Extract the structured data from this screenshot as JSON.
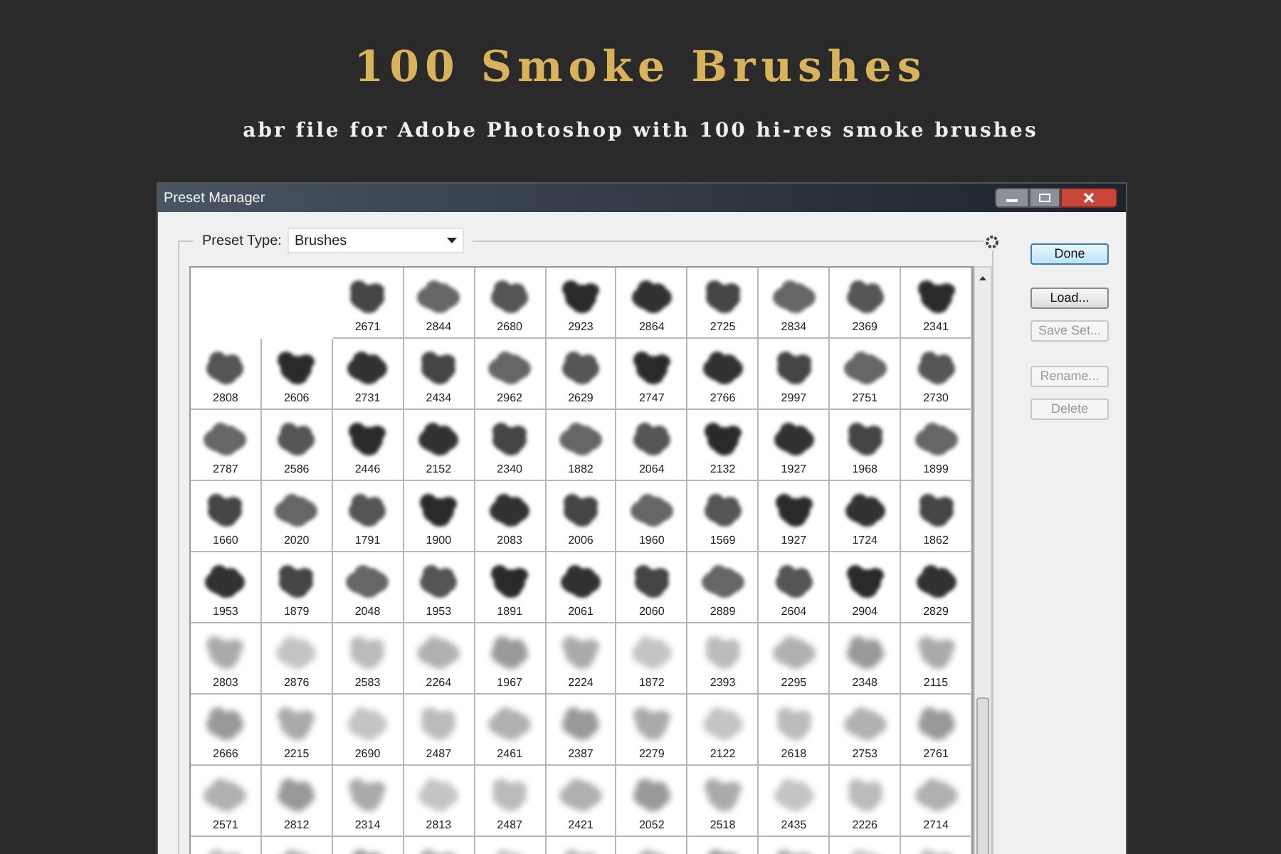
{
  "header": {
    "title": "100 Smoke Brushes",
    "subtitle": "abr file for Adobe Photoshop with 100 hi-res smoke brushes"
  },
  "window": {
    "title": "Preset Manager"
  },
  "preset_type": {
    "label": "Preset Type:",
    "value": "Brushes"
  },
  "brush_rows": [
    [
      {
        "kind": "empty"
      },
      {
        "kind": "empty"
      },
      {
        "kind": "brush",
        "label": "2671"
      },
      {
        "kind": "brush",
        "label": "2844"
      },
      {
        "kind": "brush",
        "label": "2680"
      },
      {
        "kind": "brush",
        "label": "2923"
      },
      {
        "kind": "brush",
        "label": "2864"
      },
      {
        "kind": "brush",
        "label": "2725"
      },
      {
        "kind": "brush",
        "label": "2834"
      },
      {
        "kind": "brush",
        "label": "2369"
      },
      {
        "kind": "brush",
        "label": "2341"
      }
    ],
    [
      {
        "kind": "brush",
        "label": "2808"
      },
      {
        "kind": "brush",
        "label": "2606"
      },
      {
        "kind": "brush",
        "label": "2731"
      },
      {
        "kind": "brush",
        "label": "2434"
      },
      {
        "kind": "brush",
        "label": "2962"
      },
      {
        "kind": "brush",
        "label": "2629"
      },
      {
        "kind": "brush",
        "label": "2747"
      },
      {
        "kind": "brush",
        "label": "2766"
      },
      {
        "kind": "brush",
        "label": "2997"
      },
      {
        "kind": "brush",
        "label": "2751"
      },
      {
        "kind": "brush",
        "label": "2730"
      }
    ],
    [
      {
        "kind": "brush",
        "label": "2787"
      },
      {
        "kind": "brush",
        "label": "2586"
      },
      {
        "kind": "brush",
        "label": "2446"
      },
      {
        "kind": "brush",
        "label": "2152"
      },
      {
        "kind": "brush",
        "label": "2340"
      },
      {
        "kind": "brush",
        "label": "1882"
      },
      {
        "kind": "brush",
        "label": "2064"
      },
      {
        "kind": "brush",
        "label": "2132"
      },
      {
        "kind": "brush",
        "label": "1927"
      },
      {
        "kind": "brush",
        "label": "1968"
      },
      {
        "kind": "brush",
        "label": "1899"
      }
    ],
    [
      {
        "kind": "brush",
        "label": "1660"
      },
      {
        "kind": "brush",
        "label": "2020"
      },
      {
        "kind": "brush",
        "label": "1791"
      },
      {
        "kind": "brush",
        "label": "1900"
      },
      {
        "kind": "brush",
        "label": "2083"
      },
      {
        "kind": "brush",
        "label": "2006"
      },
      {
        "kind": "brush",
        "label": "1960"
      },
      {
        "kind": "brush",
        "label": "1569"
      },
      {
        "kind": "brush",
        "label": "1927"
      },
      {
        "kind": "brush",
        "label": "1724"
      },
      {
        "kind": "brush",
        "label": "1862"
      }
    ],
    [
      {
        "kind": "brush",
        "label": "1953"
      },
      {
        "kind": "brush",
        "label": "1879"
      },
      {
        "kind": "brush",
        "label": "2048"
      },
      {
        "kind": "brush",
        "label": "1953"
      },
      {
        "kind": "brush",
        "label": "1891"
      },
      {
        "kind": "brush",
        "label": "2061"
      },
      {
        "kind": "brush",
        "label": "2060"
      },
      {
        "kind": "brush",
        "label": "2889"
      },
      {
        "kind": "brush",
        "label": "2604"
      },
      {
        "kind": "brush",
        "label": "2904"
      },
      {
        "kind": "brush",
        "label": "2829"
      }
    ],
    [
      {
        "kind": "brush",
        "label": "2803"
      },
      {
        "kind": "brush",
        "label": "2876"
      },
      {
        "kind": "brush",
        "label": "2583"
      },
      {
        "kind": "brush",
        "label": "2264"
      },
      {
        "kind": "brush",
        "label": "1967"
      },
      {
        "kind": "brush",
        "label": "2224"
      },
      {
        "kind": "brush",
        "label": "1872"
      },
      {
        "kind": "brush",
        "label": "2393"
      },
      {
        "kind": "brush",
        "label": "2295"
      },
      {
        "kind": "brush",
        "label": "2348"
      },
      {
        "kind": "brush",
        "label": "2115"
      }
    ],
    [
      {
        "kind": "brush",
        "label": "2666"
      },
      {
        "kind": "brush",
        "label": "2215"
      },
      {
        "kind": "brush",
        "label": "2690"
      },
      {
        "kind": "brush",
        "label": "2487"
      },
      {
        "kind": "brush",
        "label": "2461"
      },
      {
        "kind": "brush",
        "label": "2387"
      },
      {
        "kind": "brush",
        "label": "2279"
      },
      {
        "kind": "brush",
        "label": "2122"
      },
      {
        "kind": "brush",
        "label": "2618"
      },
      {
        "kind": "brush",
        "label": "2753"
      },
      {
        "kind": "brush",
        "label": "2761"
      }
    ],
    [
      {
        "kind": "brush",
        "label": "2571"
      },
      {
        "kind": "brush",
        "label": "2812"
      },
      {
        "kind": "brush",
        "label": "2314"
      },
      {
        "kind": "brush",
        "label": "2813"
      },
      {
        "kind": "brush",
        "label": "2487"
      },
      {
        "kind": "brush",
        "label": "2421"
      },
      {
        "kind": "brush",
        "label": "2052"
      },
      {
        "kind": "brush",
        "label": "2518"
      },
      {
        "kind": "brush",
        "label": "2435"
      },
      {
        "kind": "brush",
        "label": "2226"
      },
      {
        "kind": "brush",
        "label": "2714"
      }
    ],
    [
      {
        "kind": "brush"
      },
      {
        "kind": "brush"
      },
      {
        "kind": "brush"
      },
      {
        "kind": "brush"
      },
      {
        "kind": "brush"
      },
      {
        "kind": "brush"
      },
      {
        "kind": "brush"
      },
      {
        "kind": "brush"
      },
      {
        "kind": "brush"
      },
      {
        "kind": "brush"
      },
      {
        "kind": "brush"
      }
    ]
  ],
  "buttons": [
    {
      "label": "Done",
      "default": true,
      "disabled": false
    },
    {
      "label": "Load...",
      "default": false,
      "disabled": false
    },
    {
      "label": "Save Set...",
      "default": false,
      "disabled": true
    },
    {
      "label": "Rename...",
      "default": false,
      "disabled": true
    },
    {
      "label": "Delete",
      "default": false,
      "disabled": true
    }
  ]
}
